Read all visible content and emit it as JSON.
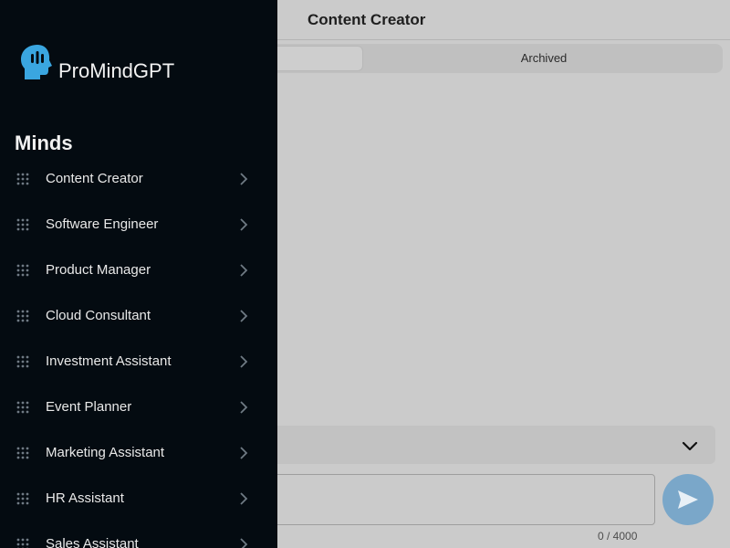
{
  "header": {
    "title": "Content Creator"
  },
  "tabs": {
    "archived_label": "Archived"
  },
  "composer": {
    "counter": "0 / 4000"
  },
  "brand": {
    "name": "ProMindGPT"
  },
  "sidebar": {
    "section_title": "Minds",
    "items": [
      {
        "label": "Content Creator"
      },
      {
        "label": "Software Engineer"
      },
      {
        "label": "Product Manager"
      },
      {
        "label": "Cloud Consultant"
      },
      {
        "label": "Investment Assistant"
      },
      {
        "label": "Event Planner"
      },
      {
        "label": "Marketing Assistant"
      },
      {
        "label": "HR Assistant"
      },
      {
        "label": "Sales Assistant"
      }
    ]
  },
  "colors": {
    "sidebar_bg": "#040b11",
    "logo": "#3aa6e0",
    "send_button": "#7aa7c9"
  },
  "icons": {
    "logo": "head-icon",
    "grip": "grip-icon",
    "arrow": "chevron-right-icon",
    "dropdown": "chevron-down-icon",
    "send": "send-icon"
  }
}
